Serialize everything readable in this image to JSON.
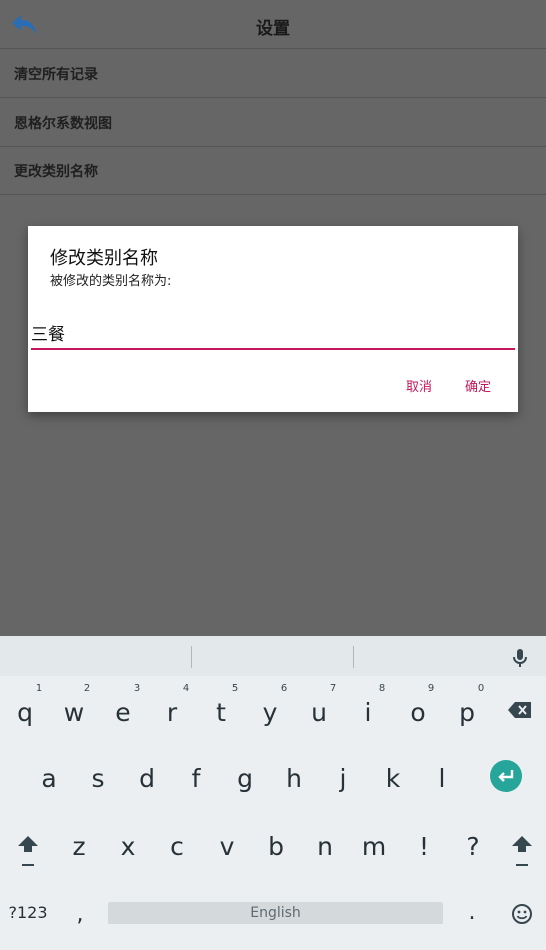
{
  "appbar": {
    "title": "设置",
    "back_icon": "back-arrow-icon"
  },
  "settings_rows": [
    {
      "label": "清空所有记录"
    },
    {
      "label": "恩格尔系数视图"
    },
    {
      "label": "更改类别名称"
    }
  ],
  "dialog": {
    "title": "修改类别名称",
    "subtitle": "被修改的类别名称为:",
    "input_value": "三餐",
    "cancel_label": "取消",
    "confirm_label": "确定",
    "accent_color": "#c2185b"
  },
  "keyboard": {
    "row1": [
      "q",
      "w",
      "e",
      "r",
      "t",
      "y",
      "u",
      "i",
      "o",
      "p"
    ],
    "row1_hints": [
      "1",
      "2",
      "3",
      "4",
      "5",
      "6",
      "7",
      "8",
      "9",
      "0"
    ],
    "row2": [
      "a",
      "s",
      "d",
      "f",
      "g",
      "h",
      "j",
      "k",
      "l"
    ],
    "row3": [
      "z",
      "x",
      "c",
      "v",
      "b",
      "n",
      "m",
      "!",
      "?"
    ],
    "symbols_label": "?123",
    "comma": ",",
    "space_label": "English",
    "period": ".",
    "enter_color": "#26a69a"
  }
}
